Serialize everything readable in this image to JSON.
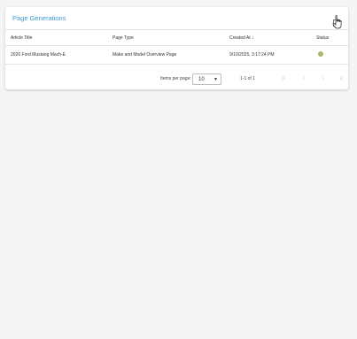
{
  "card": {
    "title": "Page Generations",
    "add_icon": "add-page-icon"
  },
  "table": {
    "columns": [
      {
        "label": "Article Title"
      },
      {
        "label": "Page Type"
      },
      {
        "label": "Created At",
        "sort": "descending",
        "sort_icon": "arrow-down-icon"
      },
      {
        "label": "Status"
      }
    ],
    "rows": [
      {
        "article_title": "2026 Ford Mustang Mach-E",
        "page_type": "Make and Model Overview Page",
        "created_at": "9/10/2025, 3:17:24 PM",
        "status": "completed",
        "status_color": "#a8b86a"
      }
    ]
  },
  "paginator": {
    "items_per_page_label": "Items per page:",
    "items_per_page_value": "10",
    "range_label": "1-1 of 1",
    "first_icon": "first-page-icon",
    "prev_icon": "chevron-left-icon",
    "next_icon": "chevron-right-icon",
    "last_icon": "last-page-icon"
  },
  "colors": {
    "accent": "#3d9bd4",
    "background": "#f5f5f5",
    "card": "#ffffff"
  }
}
